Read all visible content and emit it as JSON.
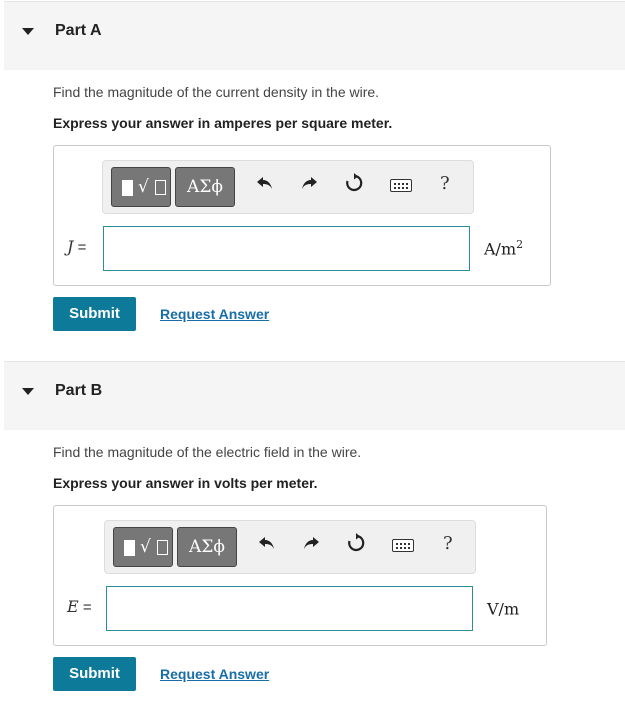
{
  "parts": [
    {
      "title": "Part A",
      "prompt": "Find the magnitude of the current density in the wire.",
      "instruction": "Express your answer in amperes per square meter.",
      "variable": "J",
      "equals": " =",
      "unit_main": "A/m",
      "unit_sup": "2",
      "input_value": "",
      "submit_label": "Submit",
      "request_label": "Request Answer"
    },
    {
      "title": "Part B",
      "prompt": "Find the magnitude of the electric field in the wire.",
      "instruction": "Express your answer in volts per meter.",
      "variable": "E",
      "equals": " =",
      "unit_main": "V/m",
      "unit_sup": "",
      "input_value": "",
      "submit_label": "Submit",
      "request_label": "Request Answer"
    }
  ],
  "toolbar": {
    "symbols_label": "ΑΣϕ",
    "radical_label": "√",
    "help_label": "?",
    "icons": [
      "templates-icon",
      "symbols-icon",
      "undo-icon",
      "redo-icon",
      "reset-icon",
      "keyboard-icon",
      "help-icon"
    ]
  },
  "colors": {
    "accent": "#0e7a99",
    "link": "#1a6ea8",
    "header_bg": "#f5f5f5",
    "input_border": "#2e8b9a"
  }
}
